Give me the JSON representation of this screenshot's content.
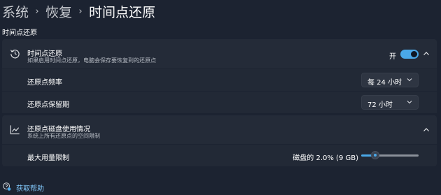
{
  "breadcrumb": {
    "items": [
      "系统",
      "恢复",
      "时间点还原"
    ],
    "separator": "›"
  },
  "section": {
    "label": "时间点还原"
  },
  "restore": {
    "title": "时间点还原",
    "description": "如果启用时间点还原，电脑会保存要恢复到的还原点",
    "toggle_label": "开",
    "toggle_on": true,
    "icon": "history-icon",
    "expanded": true
  },
  "frequency": {
    "label": "还原点频率",
    "value": "每 24 小时"
  },
  "retention": {
    "label": "还原点保留期",
    "value": "72 小时"
  },
  "disk_usage": {
    "title": "还原点磁盘使用情况",
    "description": "系统上所有还原点的空间限制",
    "icon": "chart-line-icon",
    "expanded": true
  },
  "max_usage": {
    "label": "最大用量限制",
    "value_text": "磁盘的 2.0% (9 GB)",
    "slider_fraction": 0.2
  },
  "help": {
    "label": "获取帮助",
    "icon": "help-icon"
  },
  "colors": {
    "accent": "#4aa8e8",
    "background": "#1c2331",
    "card": "#242b38"
  }
}
